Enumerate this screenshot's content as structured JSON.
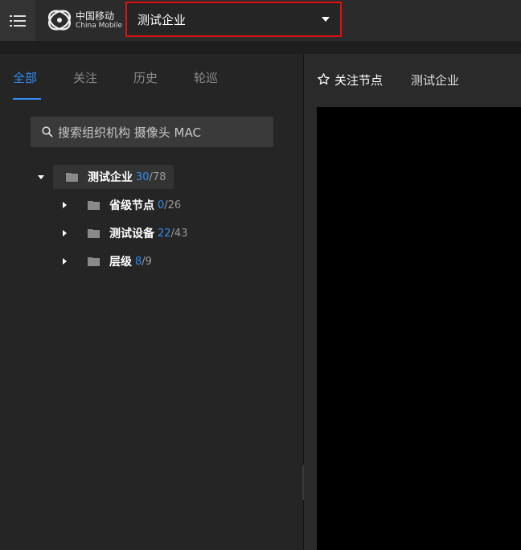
{
  "header": {
    "logo_cn": "中国移动",
    "logo_en": "China Mobile",
    "org_selected": "测试企业"
  },
  "tabs": [
    {
      "label": "全部",
      "active": true
    },
    {
      "label": "关注",
      "active": false
    },
    {
      "label": "历史",
      "active": false
    },
    {
      "label": "轮巡",
      "active": false
    }
  ],
  "search": {
    "placeholder": "搜索组织机构 摄像头 MAC"
  },
  "tree": {
    "root": {
      "label": "测试企业",
      "online": "30",
      "total": "/78",
      "expanded": true
    },
    "children": [
      {
        "label": "省级节点",
        "online": "0",
        "total": "/26"
      },
      {
        "label": "测试设备",
        "online": "22",
        "total": "/43"
      },
      {
        "label": "层级",
        "online": "8",
        "total": "/9"
      }
    ]
  },
  "collapse_glyph": "«",
  "right": {
    "follow_label": "关注节点",
    "breadcrumb": "测试企业"
  },
  "colors": {
    "accent": "#2f8cf0",
    "highlight_border": "#e01010"
  },
  "icons": [
    "menu-icon",
    "china-mobile-logo",
    "chevron-down-icon",
    "search-icon",
    "folder-icon",
    "star-icon",
    "collapse-icon"
  ]
}
